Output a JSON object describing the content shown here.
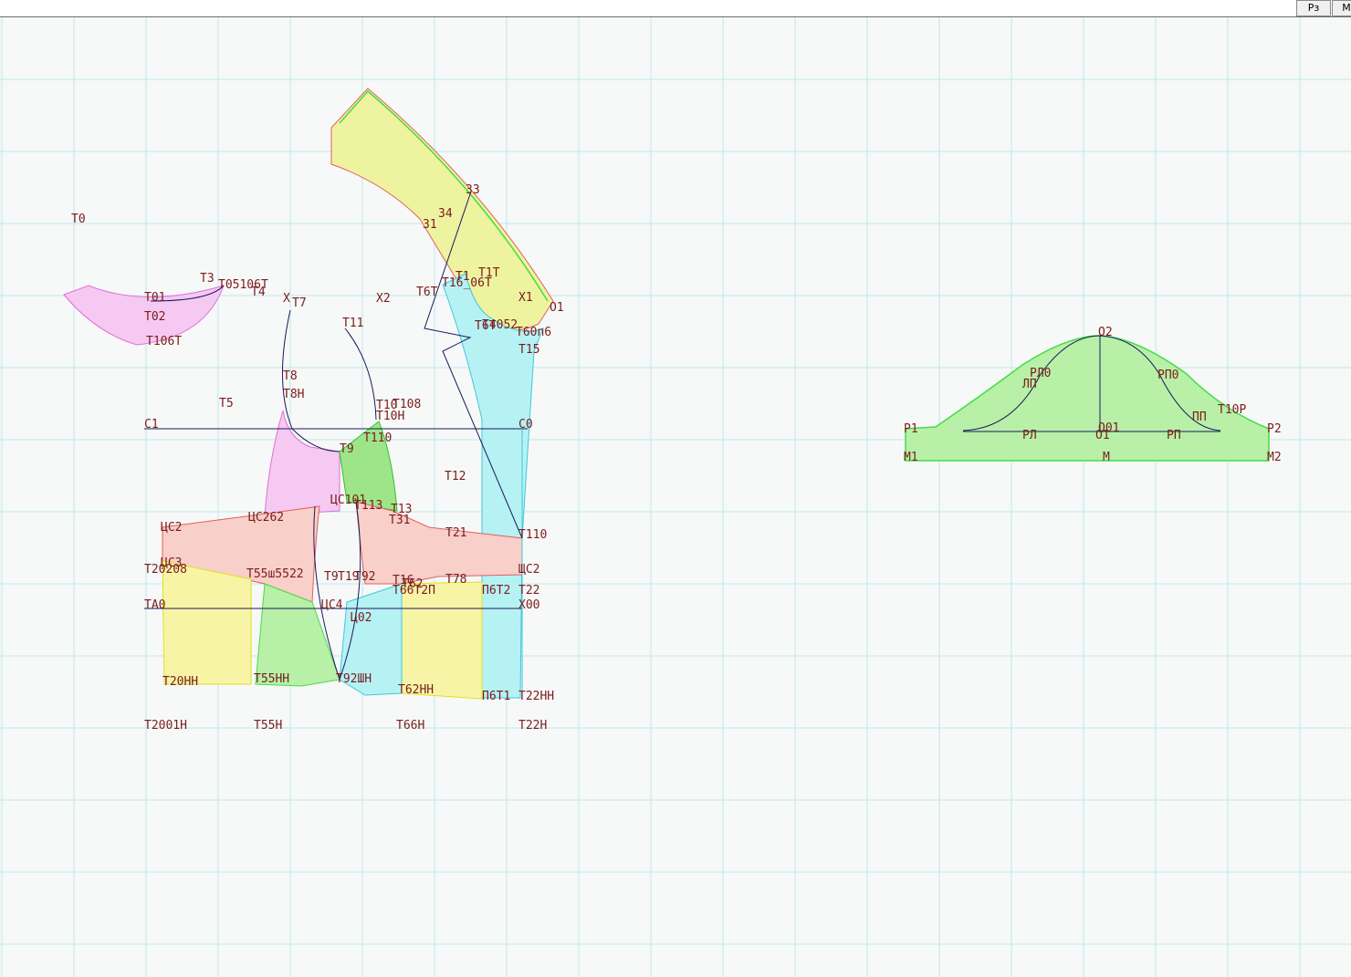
{
  "toolbar": {
    "rz_label": "Рз",
    "m_label": "М"
  },
  "colors": {
    "grid": "#bfe8ea",
    "label": "#7a1c1c",
    "pink": "#f5c9f2",
    "green": "#b8f0a8",
    "yellow": "#f8f4a6",
    "cyan": "#b6f2f4",
    "salmon": "#f8cfc9"
  },
  "pattern_labels": [
    "Т0",
    "Т3",
    "Т01",
    "Т02",
    "Т106Т",
    "Т05106Т",
    "Т4",
    "Х",
    "Т7",
    "Х2",
    "Т6Т",
    "Т16_06Т",
    "Х1",
    "О1",
    "33",
    "34",
    "31",
    "Т1",
    "Т1Т",
    "Т6Т",
    "Т15",
    "Т4052",
    "Т60п6",
    "Т11",
    "Т8",
    "Т8Н",
    "Т5",
    "Т10",
    "Т108",
    "Т10Н",
    "С1",
    "С0",
    "Т9",
    "Т110",
    "Т12",
    "ЦС101",
    "Т113",
    "Т13",
    "Т31",
    "ЦС2",
    "Т21",
    "ЦС262",
    "ЦС3",
    "Т20208",
    "Т55ш5522",
    "Т9",
    "Т19",
    "Т92",
    "Т16",
    "Т78",
    "Т62",
    "Т66Т2П",
    "П6Т2",
    "Т22",
    "ТА0",
    "ЦС4",
    "Ц02",
    "Х00",
    "Т20НН",
    "Т55НН",
    "Т92ШН",
    "Т62НН",
    "П6Т1",
    "Т22НН",
    "Т2001Н",
    "Т55Н",
    "Т66Н",
    "Т22Н",
    "Т110",
    "ЩС2"
  ],
  "sleeve_labels": [
    "О2",
    "РЛ0",
    "ЛП",
    "РП0",
    "ПП",
    "Т10Р",
    "Р1",
    "Р2",
    "РЛ",
    "О01",
    "О1",
    "РП",
    "М1",
    "М",
    "М2"
  ]
}
